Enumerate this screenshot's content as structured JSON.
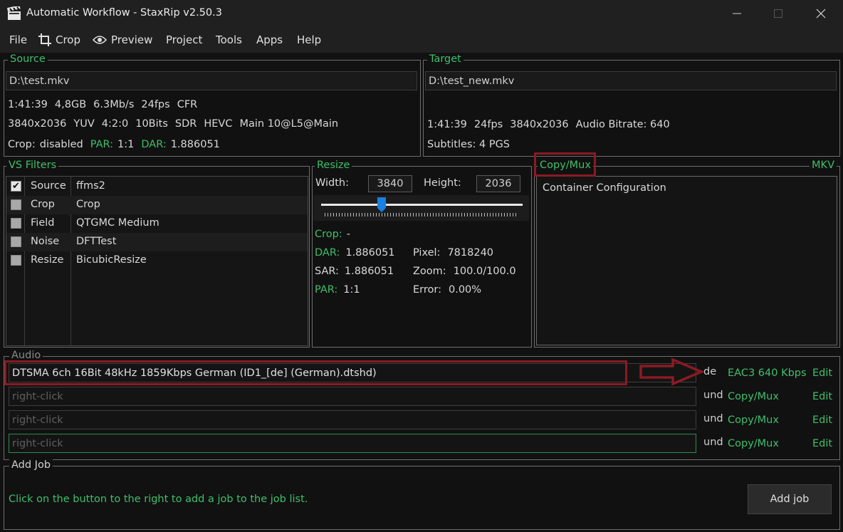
{
  "window": {
    "title": "Automatic Workflow - StaxRip v2.50.3"
  },
  "menu": [
    "File",
    "Crop",
    "Preview",
    "Project",
    "Tools",
    "Apps",
    "Help"
  ],
  "source": {
    "label": "Source",
    "path": "D:\\test.mkv",
    "row1": [
      "1:41:39",
      "4,8GB",
      "6.3Mb/s",
      "24fps",
      "CFR"
    ],
    "row2": [
      "3840x2036",
      "YUV",
      "4:2:0",
      "10Bits",
      "SDR",
      "HEVC",
      "Main 10@L5@Main"
    ],
    "crop_label": "Crop:",
    "crop_value": "disabled",
    "par_label": "PAR:",
    "par_value": "1:1",
    "dar_label": "DAR:",
    "dar_value": "1.886051"
  },
  "target": {
    "label": "Target",
    "path": "D:\\test_new.mkv",
    "row1": [
      "1:41:39",
      "24fps",
      "3840x2036",
      "Audio Bitrate: 640"
    ],
    "subtitles": "Subtitles: 4 PGS"
  },
  "filters": {
    "label": "VS Filters",
    "items": [
      {
        "category": "Source",
        "name": "ffms2",
        "checked": true
      },
      {
        "category": "Crop",
        "name": "Crop",
        "checked": false
      },
      {
        "category": "Field",
        "name": "QTGMC Medium",
        "checked": false
      },
      {
        "category": "Noise",
        "name": "DFTTest",
        "checked": false
      },
      {
        "category": "Resize",
        "name": "BicubicResize",
        "checked": false
      }
    ]
  },
  "resize": {
    "label": "Resize",
    "width_label": "Width:",
    "width": "3840",
    "height_label": "Height:",
    "height": "2036",
    "slider_level": 0.3,
    "crop_label": "Crop:",
    "crop_value": "-",
    "dar_label": "DAR:",
    "dar_value": "1.886051",
    "sar_label": "SAR:",
    "sar_value": "1.886051",
    "par_label": "PAR:",
    "par_value": "1:1",
    "pixel_label": "Pixel:",
    "pixel_value": "7818240",
    "zoom_label": "Zoom:",
    "zoom_value": "100.0/100.0",
    "error_label": "Error:",
    "error_value": "0.00%"
  },
  "container": {
    "label": "Copy/Mux",
    "format": "MKV",
    "text": "Container Configuration"
  },
  "audio": {
    "label": "Audio",
    "tracks": [
      {
        "file": "DTSMA 6ch 16Bit 48kHz 1859Kbps German (ID1_[de] (German).dtshd)",
        "lang": "de",
        "codec": "EAC3 640 Kbps",
        "edit": "Edit",
        "placeholder": false
      },
      {
        "file": "right-click",
        "lang": "und",
        "codec": "Copy/Mux",
        "edit": "Edit",
        "placeholder": true
      },
      {
        "file": "right-click",
        "lang": "und",
        "codec": "Copy/Mux",
        "edit": "Edit",
        "placeholder": true
      },
      {
        "file": "right-click",
        "lang": "und",
        "codec": "Copy/Mux",
        "edit": "Edit",
        "placeholder": true
      }
    ]
  },
  "add_job": {
    "label": "Add Job",
    "hint": "Click on the button to the right to add a job to the job list.",
    "button": "Add job"
  },
  "colors": {
    "accent": "#3fbf6a",
    "annotation": "#8b1a24",
    "background": "#111111"
  }
}
